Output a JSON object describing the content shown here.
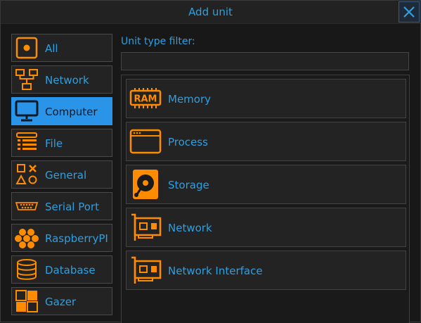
{
  "window": {
    "title": "Add unit"
  },
  "colors": {
    "accent": "#2f9fe0",
    "icon_orange": "#ff8c00",
    "selected_bg": "#2a95e8"
  },
  "categories": [
    {
      "label": "All",
      "icon": "all-icon",
      "selected": false
    },
    {
      "label": "Network",
      "icon": "network-topology-icon",
      "selected": false
    },
    {
      "label": "Computer",
      "icon": "monitor-icon",
      "selected": true
    },
    {
      "label": "File",
      "icon": "file-list-icon",
      "selected": false
    },
    {
      "label": "General",
      "icon": "shapes-icon",
      "selected": false
    },
    {
      "label": "Serial Port",
      "icon": "serial-port-icon",
      "selected": false
    },
    {
      "label": "RaspberryPI",
      "icon": "raspberry-icon",
      "selected": false
    },
    {
      "label": "Database",
      "icon": "database-icon",
      "selected": false
    },
    {
      "label": "Gazer",
      "icon": "gazer-logo-icon",
      "selected": false
    }
  ],
  "filter": {
    "label": "Unit type filter:",
    "value": ""
  },
  "units": [
    {
      "label": "Memory",
      "icon": "ram-icon"
    },
    {
      "label": "Process",
      "icon": "process-window-icon"
    },
    {
      "label": "Storage",
      "icon": "hard-disk-icon"
    },
    {
      "label": "Network",
      "icon": "network-card-icon"
    },
    {
      "label": "Network Interface",
      "icon": "network-card-icon"
    }
  ],
  "ram_icon_text": "RAM"
}
